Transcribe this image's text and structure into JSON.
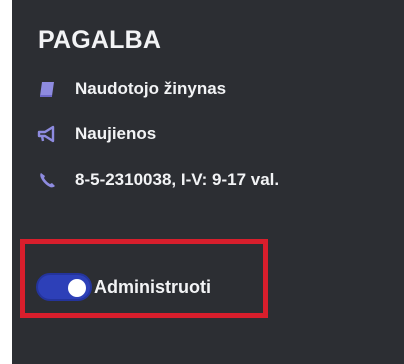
{
  "help_section": {
    "title": "PAGALBA",
    "items": [
      {
        "icon": "book-icon",
        "label": "Naudotojo žinynas"
      },
      {
        "icon": "megaphone-icon",
        "label": "Naujienos"
      },
      {
        "icon": "phone-icon",
        "label": "8-5-2310038, I-V: 9-17 val."
      }
    ]
  },
  "admin": {
    "label": "Administruoti",
    "toggle_on": true,
    "highlight_color": "#d81e2c",
    "toggle_color": "#2d40b8"
  },
  "colors": {
    "panel_background": "#2c2e33",
    "icon_color": "#8e8be0"
  }
}
